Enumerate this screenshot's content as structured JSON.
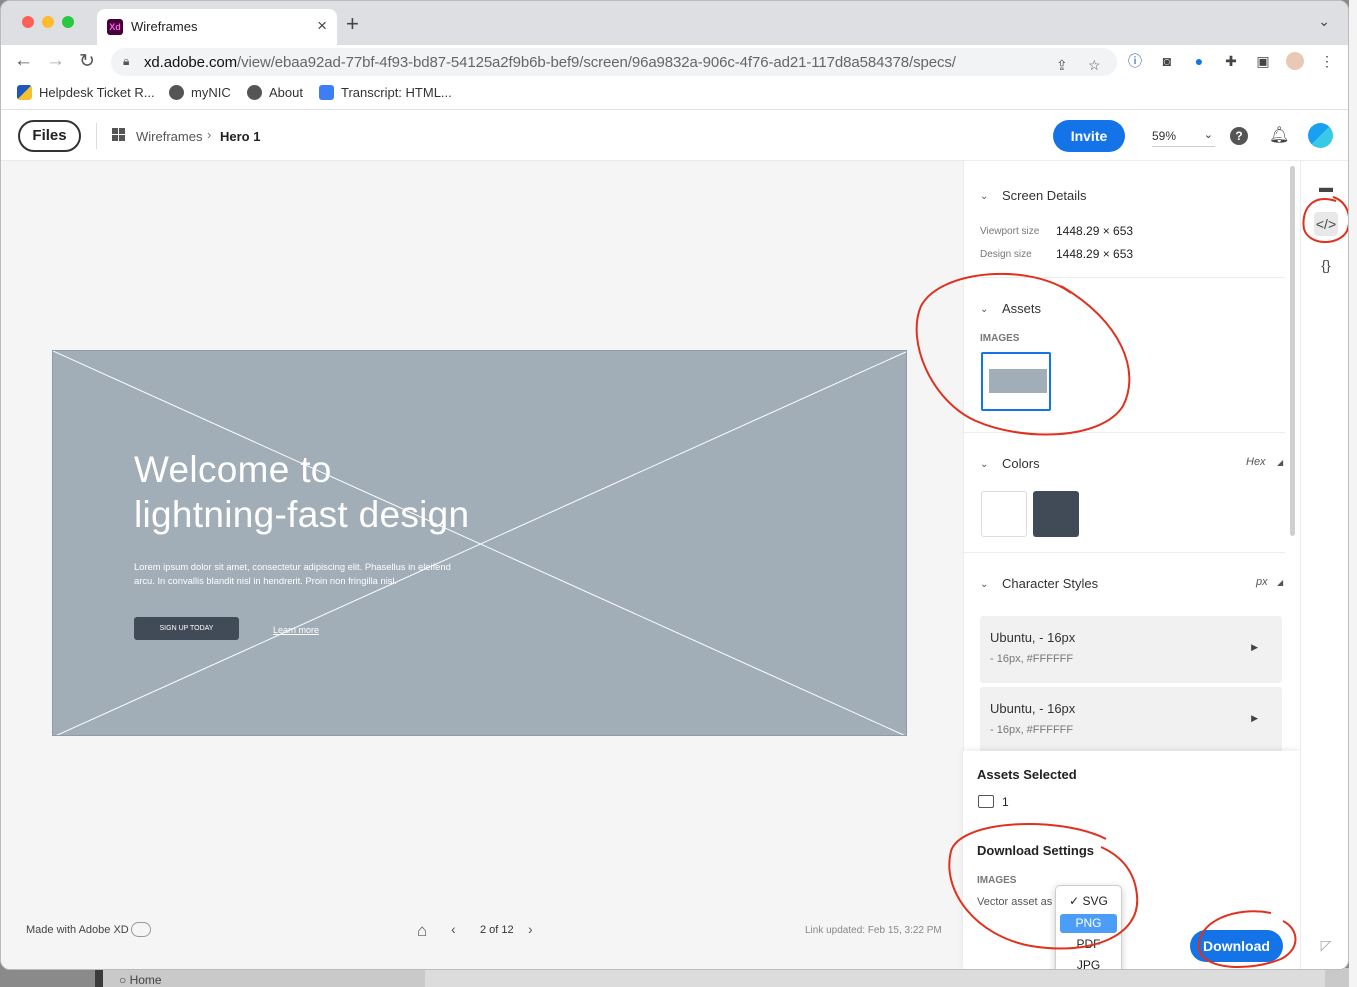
{
  "browser": {
    "tab_title": "Wireframes",
    "tab_favicon": "Xd",
    "url_host": "xd.adobe.com",
    "url_path": "/view/ebaa92ad-77bf-4f93-bd87-54125a2f9b6b-bef9/screen/96a9832a-906c-4f76-ad21-117d8a584378/specs/",
    "bookmarks": [
      {
        "label": "Helpdesk Ticket R...",
        "icon": "flag-icon"
      },
      {
        "label": "myNIC",
        "icon": "globe-icon"
      },
      {
        "label": "About",
        "icon": "globe-icon"
      },
      {
        "label": "Transcript: HTML...",
        "icon": "document-icon"
      }
    ]
  },
  "appbar": {
    "files_label": "Files",
    "breadcrumb_root": "Wireframes",
    "breadcrumb_current": "Hero 1",
    "invite_label": "Invite",
    "zoom_value": "59%"
  },
  "artboard": {
    "headline_line1": "Welcome to",
    "headline_line2": "lightning-fast design",
    "body_text": "Lorem ipsum dolor sit amet, consectetur adipiscing elit. Phasellus in eleifend arcu. In convallis blandit nisl in hendrerit. Proin non fringilla nisl.",
    "cta_label": "SIGN UP TODAY",
    "link_label": "Learn more"
  },
  "footer": {
    "made_with": "Made with Adobe XD",
    "page_count": "2 of 12",
    "link_updated": "Link updated: Feb 15, 3:22 PM"
  },
  "specs": {
    "screen_details": {
      "title": "Screen Details",
      "viewport_label": "Viewport size",
      "viewport_value": "1448.29 × 653",
      "design_label": "Design size",
      "design_value": "1448.29 × 653"
    },
    "assets": {
      "title": "Assets",
      "images_label": "IMAGES"
    },
    "colors": {
      "title": "Colors",
      "format": "Hex",
      "swatches": [
        "#FFFFFF",
        "#414A57"
      ]
    },
    "character_styles": {
      "title": "Character Styles",
      "unit": "px",
      "items": [
        {
          "name": "Ubuntu, - 16px",
          "detail": "- 16px, #FFFFFF"
        },
        {
          "name": "Ubuntu, - 16px",
          "detail": "- 16px, #FFFFFF"
        }
      ]
    }
  },
  "download": {
    "assets_selected_label": "Assets Selected",
    "assets_selected_count": "1",
    "settings_title": "Download Settings",
    "images_label": "IMAGES",
    "vector_label": "Vector asset as",
    "options": [
      "SVG",
      "PNG",
      "PDF",
      "JPG"
    ],
    "checked_option": "SVG",
    "highlighted_option": "PNG",
    "button_label": "Download"
  },
  "background": {
    "home_label": "Home"
  },
  "colors": {
    "accent": "#1473e6",
    "annotation": "#e0301e"
  }
}
